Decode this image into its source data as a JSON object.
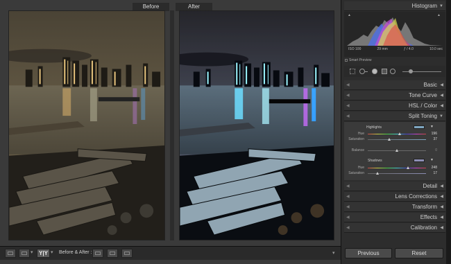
{
  "view": {
    "before_label": "Before",
    "after_label": "After"
  },
  "toolbar": {
    "grid_arrow": "▾",
    "compare_mode": "Y|Y",
    "compare_arrow": "▾",
    "before_after_label": "Before & After :",
    "menu_arrow": "▾"
  },
  "histogram": {
    "title": "Histogram",
    "iso": "ISO 100",
    "focal": "29 mm",
    "aperture": "ƒ / 4.0",
    "shutter": "10.0 sec",
    "smart_preview": "Smart Preview",
    "clip_left": "▲",
    "clip_right": "▲"
  },
  "panels": {
    "basic": "Basic",
    "tone_curve": "Tone Curve",
    "hsl_a": "HSL",
    "hsl_sep": " / ",
    "hsl_b": "Color",
    "split_toning": "Split Toning",
    "detail": "Detail",
    "lens_corrections": "Lens Corrections",
    "transform": "Transform",
    "effects": "Effects",
    "calibration": "Calibration"
  },
  "split_toning": {
    "highlights_label": "Highlights",
    "highlights_hue_label": "Hue",
    "highlights_hue": 196,
    "highlights_sat_label": "Saturation",
    "highlights_sat": 37,
    "balance_label": "Balance",
    "balance": 0,
    "shadows_label": "Shadows",
    "shadows_hue_label": "Hue",
    "shadows_hue": 248,
    "shadows_sat_label": "Saturation",
    "shadows_sat": 17,
    "highlights_color": "#7fa7c2",
    "shadows_color": "#8d8fb5"
  },
  "buttons": {
    "previous": "Previous",
    "reset": "Reset"
  }
}
